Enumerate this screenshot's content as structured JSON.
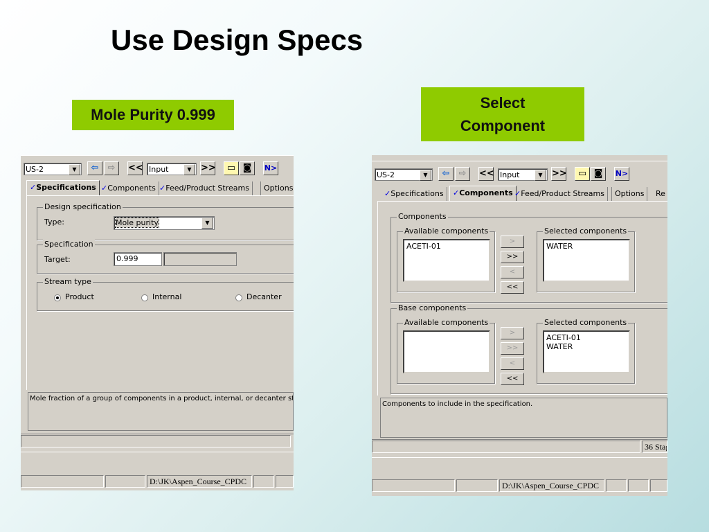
{
  "slide": {
    "title": "Use Design Specs",
    "callout_left": "Mole Purity 0.999",
    "callout_right_line1": "Select",
    "callout_right_line2": "Component"
  },
  "left_window": {
    "toolbar": {
      "block_select": "US-2",
      "mode_select": "Input",
      "prev_label": "<<",
      "next_label": ">>",
      "next_step_label": "N>"
    },
    "tabs": [
      {
        "label": "Specifications",
        "checked": true,
        "active": true
      },
      {
        "label": "Components",
        "checked": true,
        "active": false
      },
      {
        "label": "Feed/Product Streams",
        "checked": true,
        "active": false
      },
      {
        "label": "Options",
        "checked": false,
        "active": false
      }
    ],
    "design_spec": {
      "legend": "Design specification",
      "type_label": "Type:",
      "type_value": "Mole purity"
    },
    "specification": {
      "legend": "Specification",
      "target_label": "Target:",
      "target_value": "0.999"
    },
    "stream_type": {
      "legend": "Stream type",
      "options": [
        "Product",
        "Internal",
        "Decanter"
      ],
      "selected": "Product"
    },
    "prompt": "Mole fraction of a group of components in a product, internal, or decanter strea",
    "status_path": "D:\\JK\\Aspen_Course_CPDC"
  },
  "right_window": {
    "toolbar": {
      "block_select": "US-2",
      "mode_select": "Input",
      "prev_label": "<<",
      "next_label": ">>",
      "next_step_label": "N>"
    },
    "tabs": [
      {
        "label": "Specifications",
        "checked": true,
        "active": false
      },
      {
        "label": "Components",
        "checked": true,
        "active": true
      },
      {
        "label": "Feed/Product Streams",
        "checked": true,
        "active": false
      },
      {
        "label": "Options",
        "checked": false,
        "active": false
      },
      {
        "label": "Re",
        "checked": false,
        "active": false
      }
    ],
    "components": {
      "legend": "Components",
      "available_legend": "Available components",
      "available": [
        "ACETI-01"
      ],
      "selected_legend": "Selected components",
      "selected": [
        "WATER"
      ]
    },
    "base_components": {
      "legend": "Base components",
      "available_legend": "Available components",
      "available": [],
      "selected_legend": "Selected components",
      "selected": [
        "ACETI-01",
        "WATER"
      ]
    },
    "move_buttons": {
      "add": ">",
      "add_all": ">>",
      "remove": "<",
      "remove_all": "<<"
    },
    "prompt": "Components to include in the specification.",
    "status_stages": "36 Stag",
    "status_path": "D:\\JK\\Aspen_Course_CPDC"
  },
  "colors": {
    "callout_green": "#8fcb00",
    "checkmark_blue": "#0000e0",
    "window_gray": "#d4d0c8"
  }
}
